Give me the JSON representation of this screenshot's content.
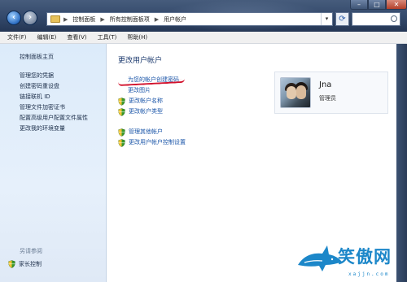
{
  "address": {
    "crumbs": [
      "控制面板",
      "所有控制面板项",
      "用户帐户"
    ],
    "separator": "▶"
  },
  "search": {
    "placeholder": ""
  },
  "menu": {
    "items": [
      "文件(F)",
      "编辑(E)",
      "查看(V)",
      "工具(T)",
      "帮助(H)"
    ]
  },
  "sidebar": {
    "home": "控制面板主页",
    "items": [
      "管理您的凭据",
      "创建密码重设盘",
      "链接联机 ID",
      "管理文件加密证书",
      "配置高级用户配置文件属性",
      "更改我的环境变量"
    ],
    "see_also": "另请参阅",
    "family_safety": "家长控制"
  },
  "main": {
    "title": "更改用户帐户",
    "links": {
      "create_password": "为您的帐户创建密码",
      "change_picture": "更改图片",
      "change_name": "更改帐户名称",
      "change_type": "更改帐户类型",
      "manage_other": "管理其他帐户",
      "uac_settings": "更改用户帐户控制设置"
    }
  },
  "user": {
    "name": "Jna",
    "role": "管理员"
  },
  "watermark": {
    "text": "笑傲网",
    "url": "xajjn.com"
  },
  "colors": {
    "link": "#1a55a8",
    "title": "#1c3a6e",
    "annotation": "#d2112c",
    "shield_green": "#3a9a2a",
    "shield_yellow": "#f1c232"
  }
}
